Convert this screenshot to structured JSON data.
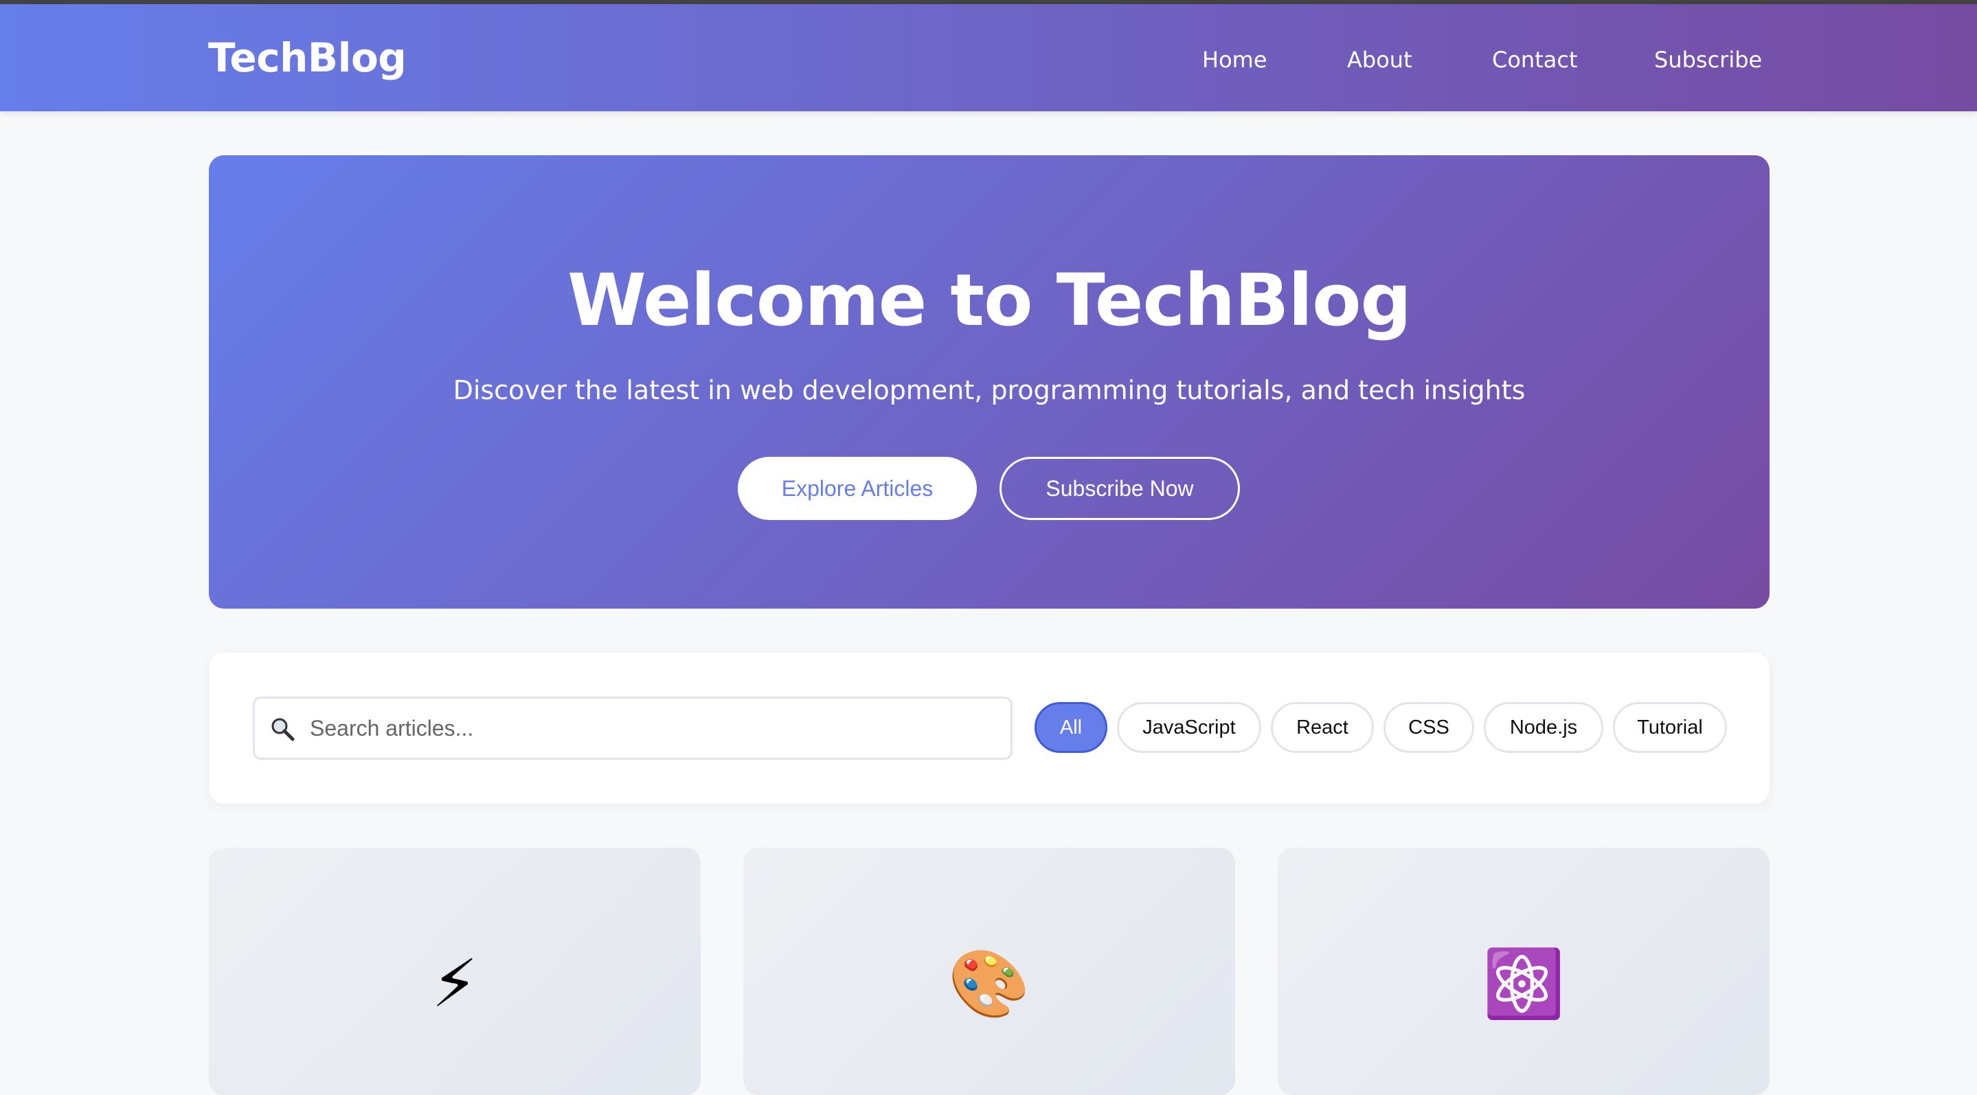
{
  "header": {
    "logo": "TechBlog",
    "nav": {
      "home": "Home",
      "about": "About",
      "contact": "Contact",
      "subscribe": "Subscribe"
    }
  },
  "hero": {
    "title": "Welcome to TechBlog",
    "subtitle": "Discover the latest in web development, programming tutorials, and tech insights",
    "explore_button": "Explore Articles",
    "subscribe_button": "Subscribe Now"
  },
  "search": {
    "placeholder": "Search articles...",
    "value": ""
  },
  "filters": {
    "items": [
      "All",
      "JavaScript",
      "React",
      "CSS",
      "Node.js",
      "Tutorial"
    ],
    "active": "All"
  },
  "cards": [
    {
      "icon": "⚡",
      "icon_name": "lightning-icon"
    },
    {
      "icon": "🎨",
      "icon_name": "palette-icon"
    },
    {
      "icon": "⚛️",
      "icon_name": "atom-icon"
    }
  ],
  "colors": {
    "gradient_start": "#667eea",
    "gradient_end": "#764ba2",
    "accent": "#667eea"
  }
}
